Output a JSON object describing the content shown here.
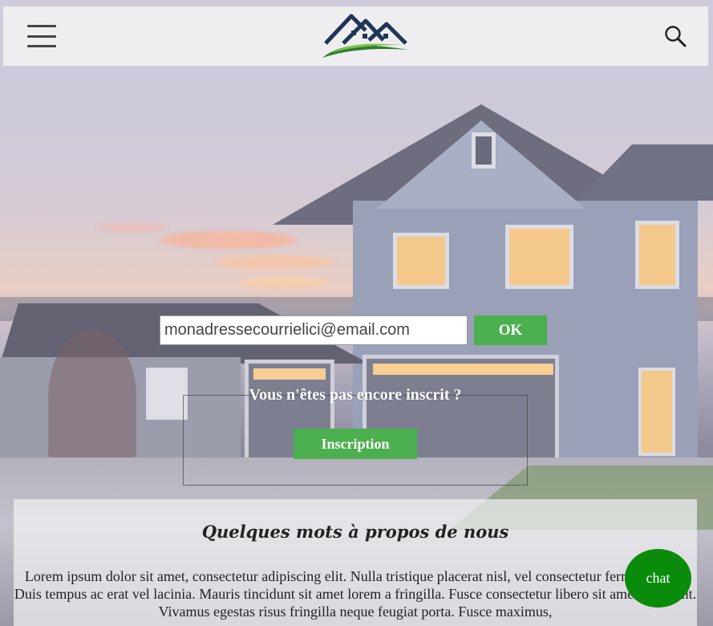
{
  "header": {
    "menu_icon": "hamburger-menu-icon",
    "logo_icon": "house-logo-icon",
    "search_icon": "search-icon"
  },
  "subscribe": {
    "email_placeholder": "monadressecourrielici@email.com",
    "ok_label": "OK"
  },
  "signup": {
    "question": "Vous n'êtes pas encore inscrit ?",
    "button_label": "Inscription"
  },
  "about": {
    "title": "Quelques mots à propos de nous",
    "text": "Lorem ipsum dolor sit amet, consectetur adipiscing elit. Nulla tristique placerat nisl, vel consectetur fermentum et. Duis tempus ac erat vel lacinia. Mauris tincidunt sit amet lorem a fringilla. Fusce consectetur libero sit amet tincidunt. Vivamus egestas risus fringilla neque feugiat porta. Fusce maximus,"
  },
  "chat": {
    "label": "chat"
  },
  "colors": {
    "accent_green": "#4caf50",
    "chat_green": "#0b8b0b",
    "header_bg": "#eeeef0"
  }
}
